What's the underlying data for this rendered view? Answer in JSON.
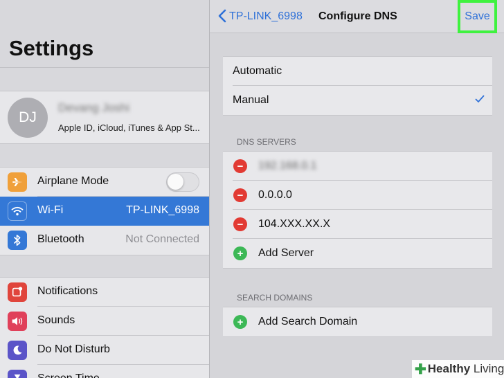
{
  "sidebar": {
    "title": "Settings",
    "profile": {
      "initials": "DJ",
      "name": "Devang Joshi",
      "subtitle": "Apple ID, iCloud, iTunes & App St..."
    },
    "connectivity": [
      {
        "label": "Airplane Mode",
        "icon": "airplane-icon",
        "color": "#f0a03a",
        "toggle_on": false
      },
      {
        "label": "Wi-Fi",
        "icon": "wifi-icon",
        "color": "#3478d6",
        "value": "TP-LINK_6998",
        "selected": true
      },
      {
        "label": "Bluetooth",
        "icon": "bluetooth-icon",
        "color": "#3478d6",
        "value": "Not Connected"
      }
    ],
    "system": [
      {
        "label": "Notifications",
        "icon": "notifications-icon",
        "color": "#e0453c"
      },
      {
        "label": "Sounds",
        "icon": "sounds-icon",
        "color": "#e0405a"
      },
      {
        "label": "Do Not Disturb",
        "icon": "moon-icon",
        "color": "#5b54c8"
      },
      {
        "label": "Screen Time",
        "icon": "hourglass-icon",
        "color": "#5b54c8"
      }
    ]
  },
  "nav": {
    "back_label": "TP-LINK_6998",
    "title": "Configure DNS",
    "save_label": "Save",
    "save_highlight": "#3ff23f"
  },
  "dns_mode": {
    "automatic_label": "Automatic",
    "manual_label": "Manual",
    "selected": "manual"
  },
  "dns_servers": {
    "header": "DNS SERVERS",
    "servers": [
      "192.168.0.1",
      "0.0.0.0",
      "104.XXX.XX.X"
    ],
    "add_label": "Add Server"
  },
  "search_domains": {
    "header": "SEARCH DOMAINS",
    "add_label": "Add Search Domain"
  },
  "watermark": {
    "brand_bold": "Healthy",
    "brand_light": " Living"
  },
  "colors": {
    "accent": "#2f71d8",
    "delete": "#e23a33",
    "add": "#3cb856",
    "selected_row": "#3478d6"
  }
}
